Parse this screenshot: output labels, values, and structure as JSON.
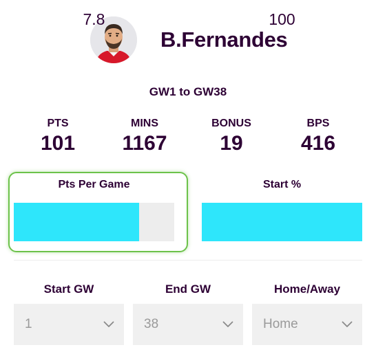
{
  "player": {
    "name": "B.Fernandes"
  },
  "range": "GW1 to GW38",
  "stats": [
    {
      "label": "PTS",
      "value": "101"
    },
    {
      "label": "MINS",
      "value": "1167"
    },
    {
      "label": "BONUS",
      "value": "19"
    },
    {
      "label": "BPS",
      "value": "416"
    }
  ],
  "metrics": {
    "pts_per_game": {
      "label": "Pts Per Game",
      "value": "7.8",
      "fill_fraction": 0.78
    },
    "start_pct": {
      "label": "Start %",
      "value": "100",
      "fill_fraction": 1.0
    }
  },
  "filters": {
    "start_gw": {
      "label": "Start GW",
      "value": "1"
    },
    "end_gw": {
      "label": "End GW",
      "value": "38"
    },
    "home_away": {
      "label": "Home/Away",
      "value": "Home"
    }
  },
  "colors": {
    "primary_text": "#2d0034",
    "bar_fill": "#2ee6fb",
    "bar_track": "#ededed",
    "highlight_border": "#6cc24a",
    "select_bg": "#f0f0f0"
  },
  "icons": {
    "avatar": "player-face-icon",
    "dropdown": "chevron-down-icon"
  }
}
